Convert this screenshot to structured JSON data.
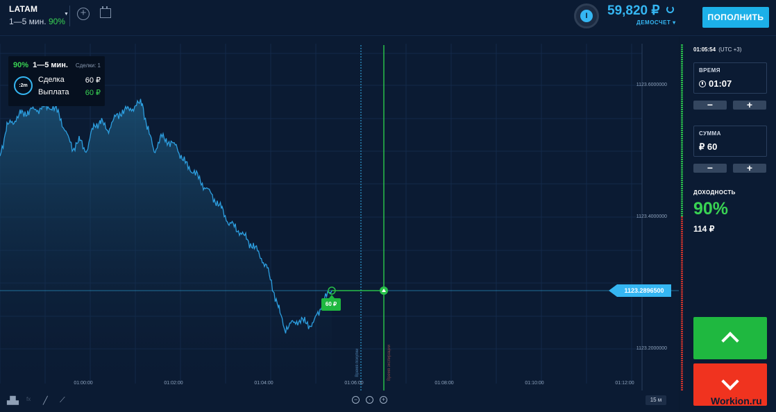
{
  "header": {
    "asset_name": "LATAM",
    "asset_range": "1—5 мин.",
    "asset_payout": "90%",
    "level_letter": "I",
    "balance": "59,820 ₽",
    "account_type": "ДЕМОСЧЕТ",
    "topup_label": "ПОПОЛНИТЬ"
  },
  "trade_panel": {
    "payout": "90%",
    "range": "1—5 мин.",
    "deals": "Сделки: 1",
    "timer": ":2m",
    "deal_label": "Сделка",
    "deal_value": "60 ₽",
    "payout_label": "Выплата",
    "payout_value": "60 ₽"
  },
  "chart": {
    "price_labels": [
      "1123.6000000",
      "1123.4000000",
      "1123.2000000"
    ],
    "time_labels": [
      "01:00:00",
      "01:02:00",
      "01:04:00",
      "01:06:00",
      "01:08:00",
      "01:10:00",
      "01:12:00"
    ],
    "current_price": "1123.2896500",
    "deal_marker": "60 ₽",
    "buy_line_label": "Время покупки",
    "expiry_line_label": "Время экспирации",
    "timeframe": "15 м"
  },
  "right_panel": {
    "clock_time": "01:05:54",
    "clock_tz": "(UTC +3)",
    "time_label": "ВРЕМЯ",
    "time_value": "01:07",
    "amount_label": "СУММА",
    "amount_value": "₽ 60",
    "minus": "−",
    "plus": "+",
    "yield_label": "ДОХОДНОСТЬ",
    "yield_pct": "90%",
    "yield_amount": "114 ₽"
  },
  "colors": {
    "background": "#0b1b33",
    "accent": "#35b6f2",
    "up": "#1fb840",
    "down": "#f0331f"
  },
  "watermark": "Workion.ru"
}
